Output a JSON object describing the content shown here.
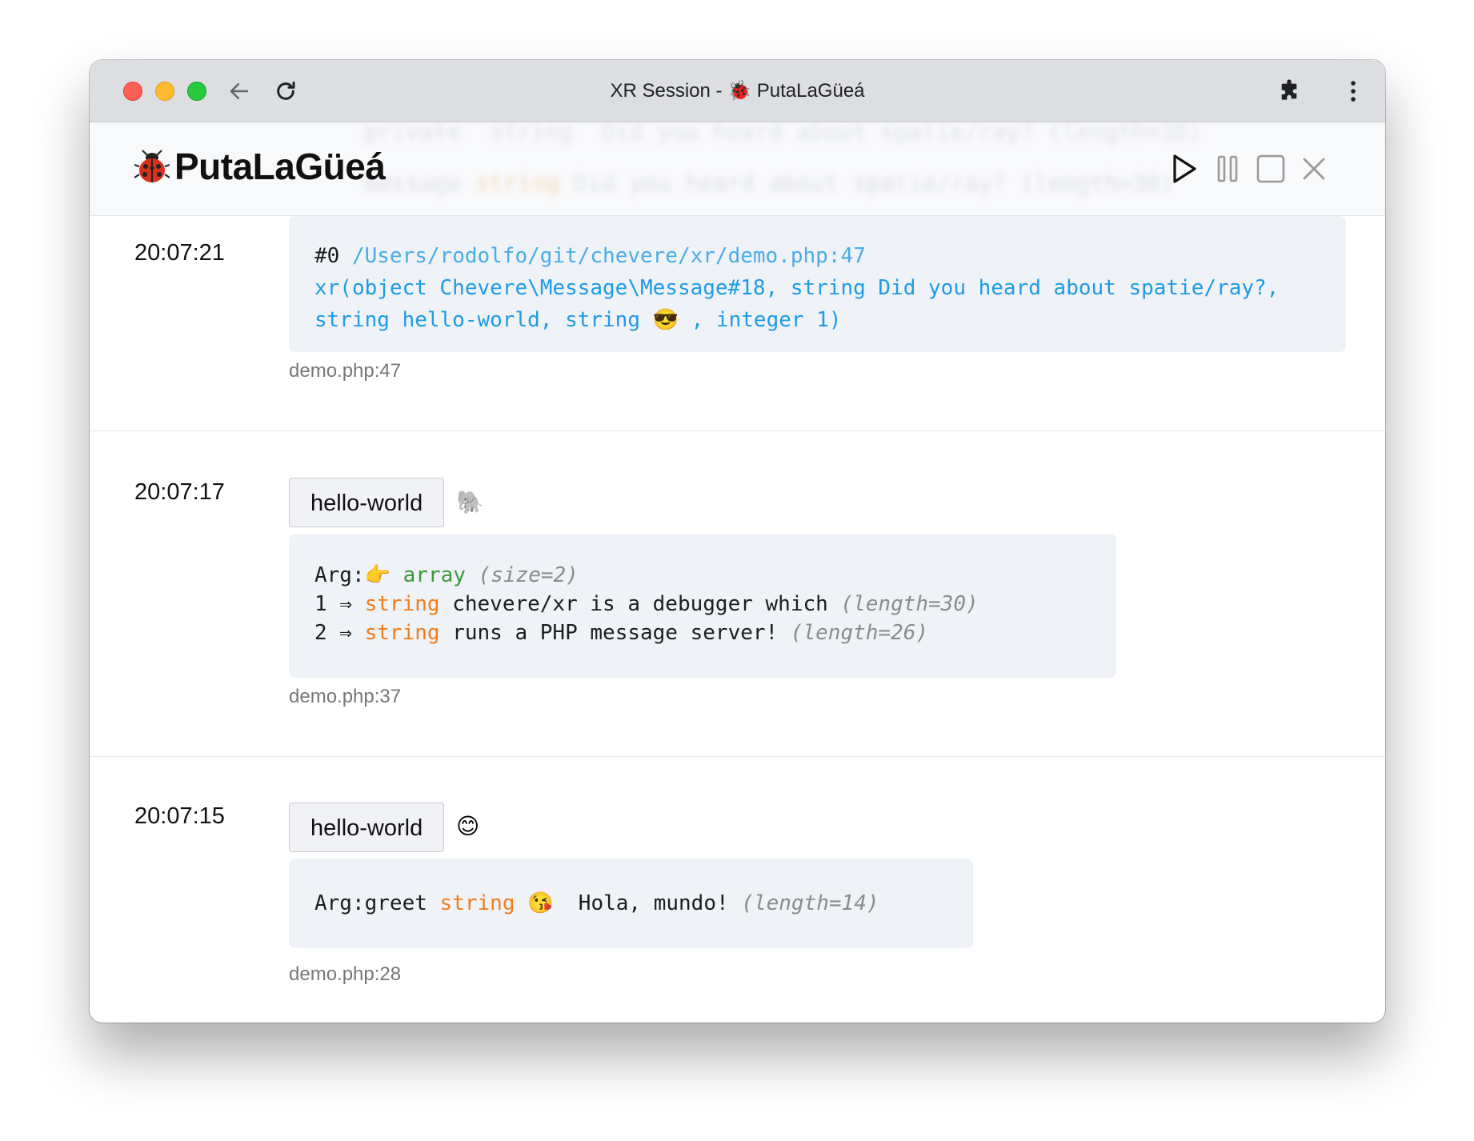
{
  "window": {
    "title": "XR Session - 🐞 PutaLaGüeá"
  },
  "toolbar_icons": {
    "back": "arrow-left-icon",
    "reload": "reload-icon",
    "extensions": "puzzle-icon",
    "menu": "kebab-menu-icon"
  },
  "app": {
    "brand": "PutaLaGüeá",
    "brand_icon": "ladybug-icon",
    "ghost_line1": "   private  string  Did you heard about spatie/ray? (length=30)",
    "ghost_line2a": "   message ",
    "ghost_line2b": "string",
    "ghost_line2c": " Did you heard about spatie/ray? (length=30)",
    "controls": [
      "play-icon",
      "pause-icon",
      "stop-icon",
      "close-icon"
    ]
  },
  "entries": [
    {
      "time": "20:07:21",
      "code": {
        "hash": "#0",
        "path": "/Users/rodolfo/git/chevere/xr/demo.php:47",
        "call_line1": "xr(object Chevere\\Message\\Message#18, string Did you heard about spatie/ray?,",
        "call_line2a": "string hello-world, string ",
        "call_emoji": "😎",
        "call_line2b": " , integer 1)"
      },
      "file": "demo.php:47"
    },
    {
      "time": "20:07:17",
      "tag": "hello-world",
      "tag_emoji": "🐘",
      "code": {
        "l1_prefix": "Arg:",
        "l1_emoji": "👉",
        "l1_type": "array",
        "l1_meta": "(size=2)",
        "l2_key": "1 ⇒ ",
        "l2_type": "string",
        "l2_val": " chevere/xr is a debugger which ",
        "l2_meta": "(length=30)",
        "l3_key": "2 ⇒ ",
        "l3_type": "string",
        "l3_val": " runs a PHP message server! ",
        "l3_meta": "(length=26)"
      },
      "file": "demo.php:37"
    },
    {
      "time": "20:07:15",
      "tag": "hello-world",
      "tag_emoji": "😊",
      "code": {
        "prefix": "Arg:greet ",
        "type": "string",
        "emoji": "😘",
        "val": "  Hola, mundo! ",
        "meta": "(length=14)"
      },
      "file": "demo.php:28"
    }
  ]
}
